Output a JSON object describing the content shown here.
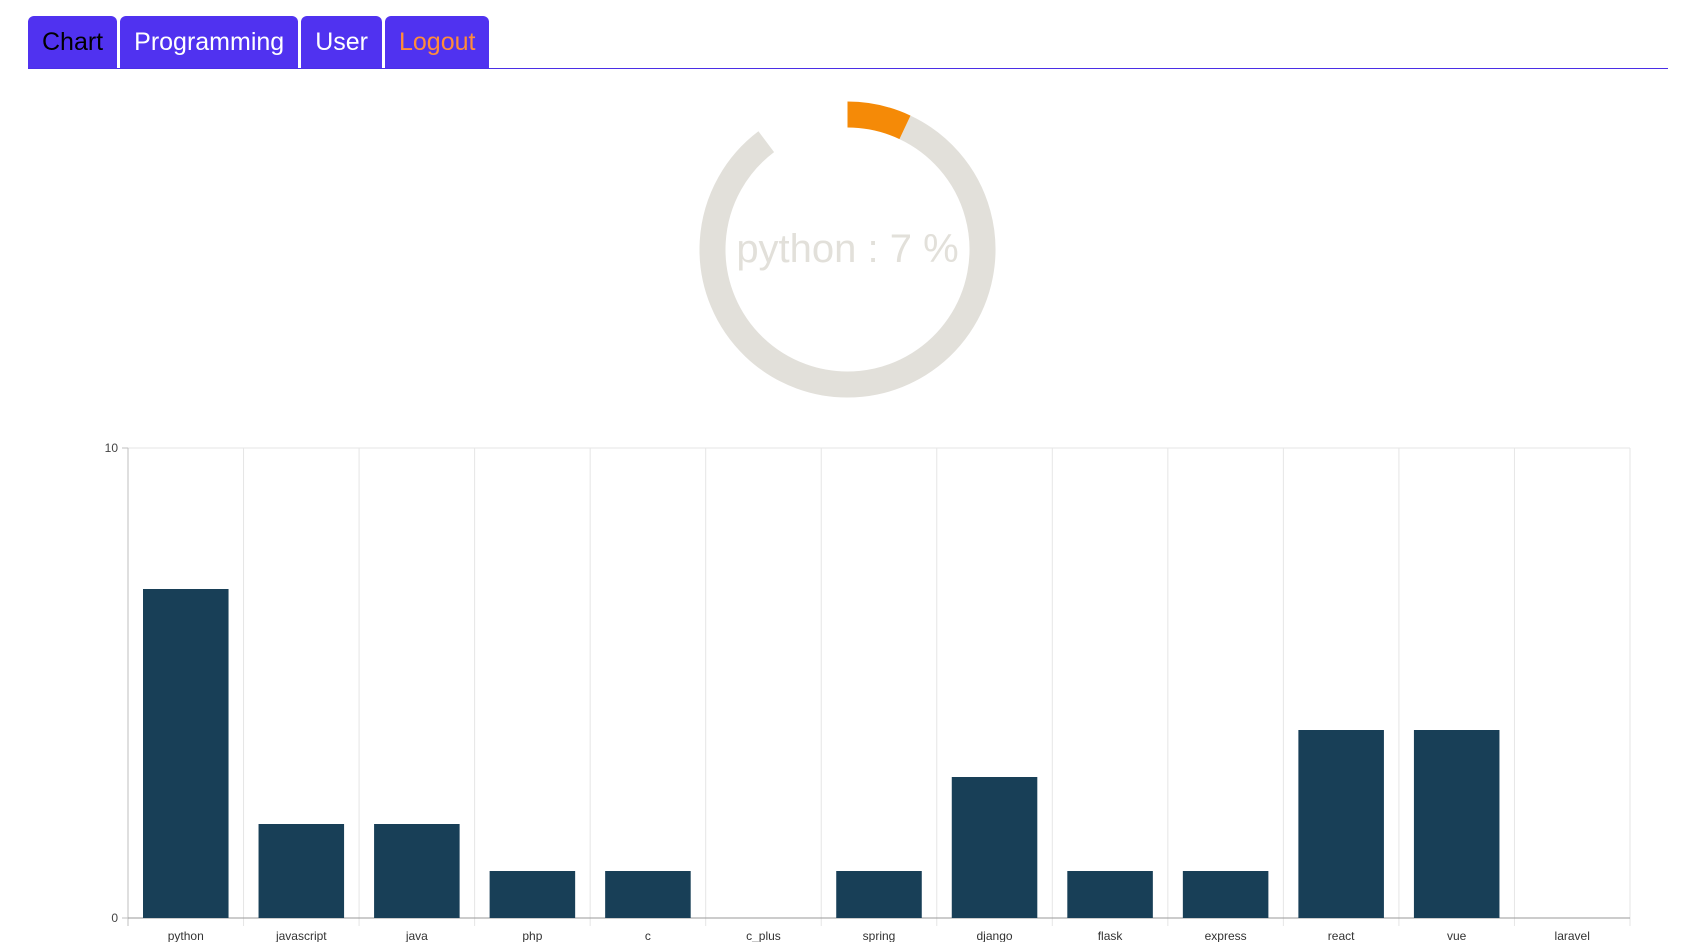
{
  "nav": {
    "tabs": [
      {
        "label": "Chart",
        "name": "tab-chart",
        "state": "active"
      },
      {
        "label": "Programming",
        "name": "tab-programming",
        "state": "normal"
      },
      {
        "label": "User",
        "name": "tab-user",
        "state": "normal"
      },
      {
        "label": "Logout",
        "name": "tab-logout",
        "state": "logout"
      }
    ],
    "colors": {
      "tab_bg": "#5032f0",
      "logout_text": "#ff8c3a"
    }
  },
  "donut": {
    "label": "python : 7 %",
    "percent": 7,
    "colors": {
      "track": "#e2e0da",
      "highlight": "#f58a07"
    }
  },
  "chart_data": {
    "type": "bar",
    "categories": [
      "python",
      "javascript",
      "java",
      "php",
      "c",
      "c_plus",
      "spring",
      "django",
      "flask",
      "express",
      "react",
      "vue",
      "laravel"
    ],
    "values": [
      7,
      2,
      2,
      1,
      1,
      0,
      1,
      3,
      1,
      1,
      4,
      4,
      0
    ],
    "ylim": [
      0,
      10
    ],
    "yticks": [
      0,
      10
    ],
    "grid": true,
    "bar_color": "#183f57"
  }
}
